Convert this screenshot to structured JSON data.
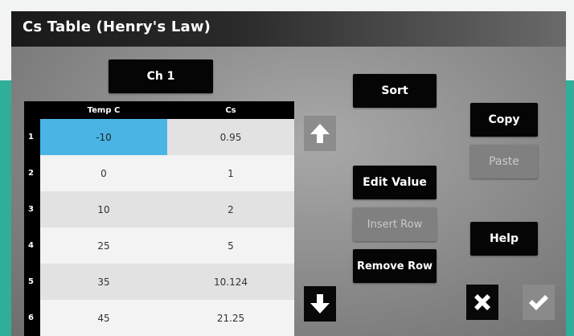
{
  "window": {
    "title": "Cs Table (Henry's Law)"
  },
  "channel": {
    "label": "Ch 1"
  },
  "table": {
    "headers": [
      "Temp C",
      "Cs"
    ],
    "rows": [
      {
        "num": "1",
        "temp": "-10",
        "cs": "0.95"
      },
      {
        "num": "2",
        "temp": "0",
        "cs": "1"
      },
      {
        "num": "3",
        "temp": "10",
        "cs": "2"
      },
      {
        "num": "4",
        "temp": "25",
        "cs": "5"
      },
      {
        "num": "5",
        "temp": "35",
        "cs": "10.124"
      },
      {
        "num": "6",
        "temp": "45",
        "cs": "21.25"
      }
    ],
    "selected_cell": {
      "row": 1,
      "column": "Temp C"
    }
  },
  "buttons": {
    "sort": "Sort",
    "edit_value": "Edit Value",
    "insert_row": "Insert Row",
    "remove_row": "Remove Row",
    "copy": "Copy",
    "paste": "Paste",
    "help": "Help"
  },
  "icons": {
    "scroll_up": "arrow-up-icon",
    "scroll_down": "arrow-down-icon",
    "cancel": "close-icon",
    "confirm": "checkmark-icon"
  },
  "colors": {
    "selection": "#4ab5e4",
    "button": "#050505",
    "disabled_button": "#808080",
    "frame": "#2fae9a"
  }
}
